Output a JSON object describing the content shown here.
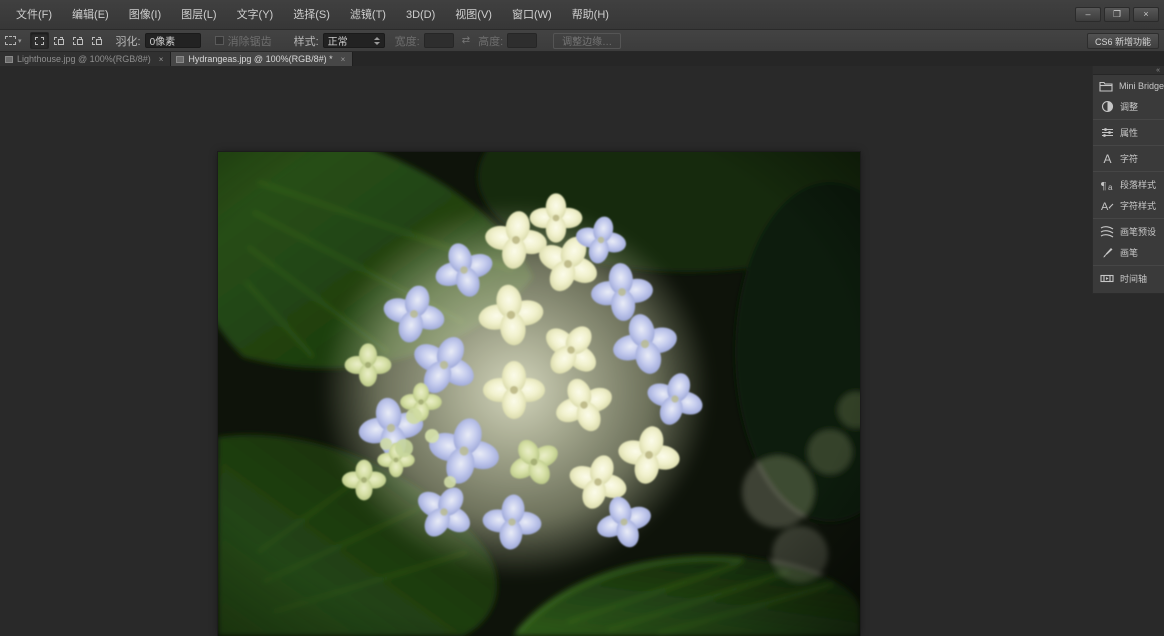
{
  "window": {
    "controls": {
      "minimize": "–",
      "restore": "❐",
      "close": "×"
    }
  },
  "menu_bar": {
    "items": [
      {
        "label": "文件(F)"
      },
      {
        "label": "编辑(E)"
      },
      {
        "label": "图像(I)"
      },
      {
        "label": "图层(L)"
      },
      {
        "label": "文字(Y)"
      },
      {
        "label": "选择(S)"
      },
      {
        "label": "滤镜(T)"
      },
      {
        "label": "3D(D)"
      },
      {
        "label": "视图(V)"
      },
      {
        "label": "窗口(W)"
      },
      {
        "label": "帮助(H)"
      }
    ]
  },
  "options_bar": {
    "feather_label": "羽化:",
    "feather_value": "0像素",
    "antialias_label": "消除锯齿",
    "style_label": "样式:",
    "style_value": "正常",
    "width_label": "宽度:",
    "height_label": "高度:",
    "link_glyph": "⇄",
    "refine_edge_label": "调整边缘…",
    "workspace_label": "CS6 新增功能"
  },
  "tabs": [
    {
      "label": "Lighthouse.jpg @ 100%(RGB/8#)",
      "close": "×",
      "active": false
    },
    {
      "label": "Hydrangeas.jpg @ 100%(RGB/8#) *",
      "close": "×",
      "active": true
    }
  ],
  "right_dock": {
    "collapse_glyph": "«",
    "groups": [
      {
        "items": [
          {
            "label": "Mini Bridge",
            "icon": "mini-bridge"
          },
          {
            "label": "调整",
            "icon": "adjustments"
          }
        ]
      },
      {
        "items": [
          {
            "label": "属性",
            "icon": "properties"
          }
        ]
      },
      {
        "items": [
          {
            "label": "字符",
            "icon": "character"
          }
        ]
      },
      {
        "items": [
          {
            "label": "段落样式",
            "icon": "paragraph-styles"
          },
          {
            "label": "字符样式",
            "icon": "character-styles"
          }
        ]
      },
      {
        "items": [
          {
            "label": "画笔预设",
            "icon": "brush-presets"
          },
          {
            "label": "画笔",
            "icon": "brush"
          }
        ]
      },
      {
        "items": [
          {
            "label": "时间轴",
            "icon": "timeline"
          }
        ]
      }
    ]
  },
  "canvas": {
    "description": "Photograph of a blue and cream hydrangea bloom among dark green leaves",
    "colors": {
      "petal_blue": "#aab6e4",
      "petal_cream": "#f0f0d0",
      "bud_green": "#d3dfa4",
      "leaf_green": "#2b5418",
      "leaf_dark": "#12230a",
      "pasteboard": "#292929"
    }
  }
}
